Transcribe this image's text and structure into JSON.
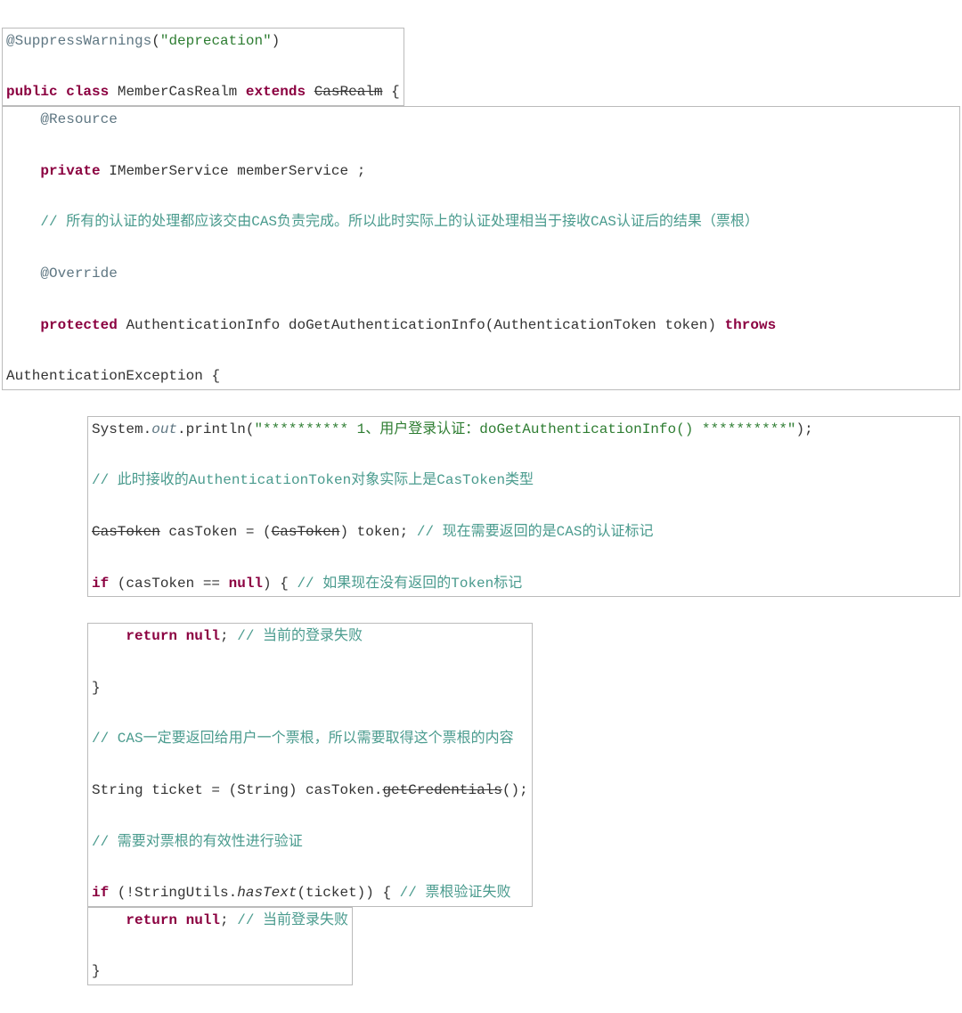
{
  "code": {
    "annotation_suppress": "@SuppressWarnings",
    "annotation_suppress_arg": "(\"deprecation\")",
    "kw_public": "public",
    "kw_class": "class",
    "class_name": "MemberCasRealm",
    "kw_extends": "extends",
    "super_class": "CasRealm",
    "brace_open": " {",
    "annotation_resource": "@Resource",
    "kw_private": "private",
    "type_imemberservice": "IMemberService",
    "field_memberservice": "memberService ;",
    "comment_auth_delegate": "// 所有的认证的处理都应该交由CAS负责完成。所以此时实际上的认证处理相当于接收CAS认证后的结果（票根）",
    "annotation_override": "@Override",
    "kw_protected": "protected",
    "type_authinfo": "AuthenticationInfo",
    "method_dogetauth": "doGetAuthenticationInfo(AuthenticationToken token)",
    "kw_throws": "throws",
    "exception_type": "AuthenticationException {",
    "sysout_prefix": "System.",
    "sysout_out": "out",
    "sysout_println": ".println(",
    "sysout_string": "\"********** 1、用户登录认证：doGetAuthenticationInfo() **********\"",
    "sysout_end": ");",
    "comment_castoken_type": "// 此时接收的AuthenticationToken对象实际上是CasToken类型",
    "castoken_type": "CasToken",
    "castoken_var": " casToken = (",
    "castoken_cast": "CasToken",
    "castoken_end": ") token; ",
    "comment_cas_marker": "// 现在需要返回的是CAS的认证标记",
    "kw_if": "if",
    "if_condition_1": " (casToken == ",
    "kw_null": "null",
    "if_brace_1": ") { ",
    "comment_no_token": "// 如果现在没有返回的Token标记",
    "kw_return": "return",
    "return_null_1": " ",
    "semicolon_1": "; ",
    "comment_login_fail_1": "// 当前的登录失败",
    "brace_close_1": "}",
    "comment_ticket_content": "// CAS一定要返回给用户一个票根，所以需要取得这个票根的内容",
    "string_type": "String ticket = (String) casToken.",
    "getcredentials": "getCredentials",
    "getcredentials_end": "();",
    "comment_validate_ticket": "// 需要对票根的有效性进行验证",
    "if_condition_2": " (!StringUtils.",
    "hastext": "hasText",
    "if_condition_2_end": "(ticket)) { ",
    "comment_ticket_fail": "// 票根验证失败",
    "comment_login_fail_2": "// 当前登录失败",
    "brace_close_2": "}"
  }
}
